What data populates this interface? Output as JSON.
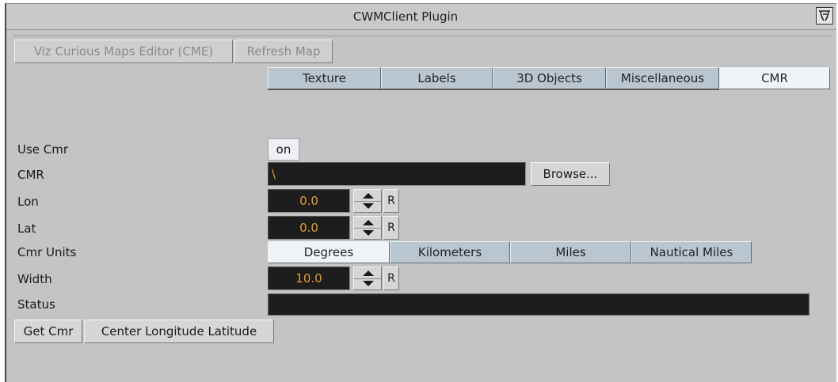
{
  "window": {
    "title": "CWMClient Plugin"
  },
  "toolbar": {
    "cme_label": "Viz Curious Maps Editor (CME)",
    "refresh_label": "Refresh Map"
  },
  "tabs": [
    {
      "label": "Texture",
      "active": false
    },
    {
      "label": "Labels",
      "active": false
    },
    {
      "label": "3D Objects",
      "active": false
    },
    {
      "label": "Miscellaneous",
      "active": false
    },
    {
      "label": "CMR",
      "active": true
    }
  ],
  "form": {
    "use_cmr": {
      "label": "Use Cmr",
      "value": "on"
    },
    "cmr": {
      "label": "CMR",
      "value": "\\",
      "browse_label": "Browse..."
    },
    "lon": {
      "label": "Lon",
      "value": "0.0",
      "reset_label": "R"
    },
    "lat": {
      "label": "Lat",
      "value": "0.0",
      "reset_label": "R"
    },
    "units": {
      "label": "Cmr Units",
      "options": [
        "Degrees",
        "Kilometers",
        "Miles",
        "Nautical Miles"
      ],
      "selected": "Degrees"
    },
    "width": {
      "label": "Width",
      "value": "10.0",
      "reset_label": "R"
    },
    "status": {
      "label": "Status",
      "value": ""
    }
  },
  "actions": {
    "get_cmr_label": "Get Cmr",
    "center_label": "Center Longitude Latitude"
  },
  "colors": {
    "panel": "#c4c4c4",
    "tab": "#b9c6cf",
    "tab_active": "#f0f4f8",
    "field_bg": "#1d1d1d",
    "field_text": "#e0a030"
  }
}
